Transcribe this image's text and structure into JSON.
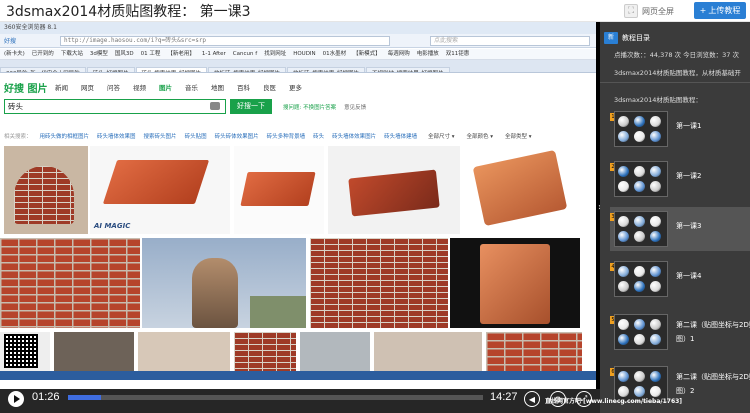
{
  "page": {
    "title": "3dsmax2014材质贴图教程： 第一课3",
    "fullscreen_label": "网页全屏",
    "upload_label": "上传教程"
  },
  "browser": {
    "window_title": "360安全浏览器 8.1",
    "back_label": "好搜",
    "url": "http://image.haosou.com/i?q=砖头&src=srp",
    "search_placeholder": "点此搜索",
    "bookmarks": [
      "(新卡夫)",
      "已开到的",
      "下载大站",
      "3d模型",
      "国风3D",
      "01 工程",
      "【新老用】",
      "1-1 After",
      "Cancun f",
      "找到网址",
      "HOUDIN",
      "01水墨材",
      "【新模式】",
      "每週网购",
      "电影播放",
      "双11钜惠"
    ],
    "tabs": [
      "360导航_新一代安全上网导航",
      "砖头_好搜图片",
      "砖头 搜索结果_好搜图片",
      "地板砖_搜索结果_好搜图片",
      "地板砖_搜索结果_好搜图片",
      "不规则地_搜索结果_好搜图片"
    ]
  },
  "search": {
    "logo": "好搜 图片",
    "nav": [
      "新闻",
      "网页",
      "问答",
      "视频",
      "图片",
      "音乐",
      "地图",
      "百科",
      "良医",
      "更多"
    ],
    "active_nav": "图片",
    "query": "砖头",
    "button": "好搜一下",
    "links": [
      "搜问题: 不换图片答案",
      "意见反馈"
    ],
    "related_label": "相关搜索：",
    "related": [
      "用砖头做的相框图片",
      "砖头墙体效果图",
      "搜索砖头图片",
      "砖头贴图",
      "砖头砖体效果图片",
      "砖头多种背景墙",
      "砖头",
      "砖头墙体效果图片",
      "砖头墙体建墙"
    ],
    "filters": [
      "全部尺寸",
      "全部颜色",
      "全部类型"
    ]
  },
  "player": {
    "current_time": "01:26",
    "end_time": "14:27",
    "progress": 0.08,
    "watermark": "www.linecg.com/tieba/1763",
    "watermark_brand": "直线网官方吧"
  },
  "side": {
    "tab_new": "新",
    "tab_catalog": "教程目录",
    "stats": "点播次数：：44,378 次 今日浏览数：37 次",
    "description": "3dsmax2014材质贴图教程，从材质基础开",
    "course_title": "3dsmax2014材质贴图教程：",
    "lessons": [
      {
        "num": "1",
        "label": "第一课1"
      },
      {
        "num": "2",
        "label": "第一课2"
      },
      {
        "num": "3",
        "label": "第一课3"
      },
      {
        "num": "4",
        "label": "第一课4"
      },
      {
        "num": "5",
        "label": "第二课（贴图坐标与2D贴",
        "label2": "图）1"
      },
      {
        "num": "6",
        "label": "第二课（贴图坐标与2D贴",
        "label2": "图）2"
      }
    ]
  },
  "colors": {
    "accent": "#2a7fd4",
    "search_green": "#19a14a",
    "side_bg": "#3b3b3b",
    "brick": "#b3401f"
  }
}
